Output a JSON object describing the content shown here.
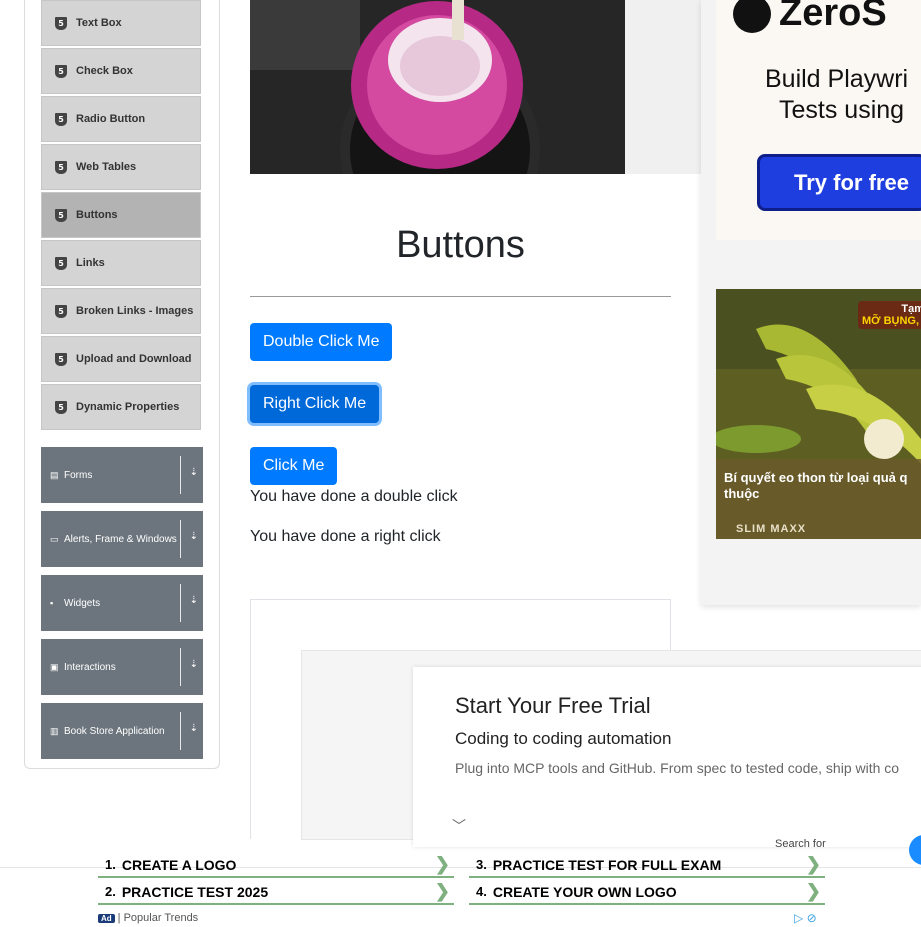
{
  "sidebar": {
    "items": [
      {
        "label": "Text Box",
        "icon": "html5-icon"
      },
      {
        "label": "Check Box",
        "icon": "html5-icon"
      },
      {
        "label": "Radio Button",
        "icon": "html5-icon"
      },
      {
        "label": "Web Tables",
        "icon": "html5-icon"
      },
      {
        "label": "Buttons",
        "icon": "html5-icon",
        "active": true
      },
      {
        "label": "Links",
        "icon": "html5-icon"
      },
      {
        "label": "Broken Links - Images",
        "icon": "html5-icon"
      },
      {
        "label": "Upload and Download",
        "icon": "html5-icon"
      },
      {
        "label": "Dynamic Properties",
        "icon": "html5-icon"
      }
    ],
    "groups": [
      {
        "label": "Forms",
        "icon": "form-icon"
      },
      {
        "label": "Alerts, Frame & Windows",
        "icon": "window-icon"
      },
      {
        "label": "Widgets",
        "icon": "grid-icon"
      },
      {
        "label": "Interactions",
        "icon": "interaction-icon"
      },
      {
        "label": "Book Store Application",
        "icon": "book-icon"
      }
    ]
  },
  "main": {
    "title": "Buttons",
    "buttons": {
      "double": "Double Click Me",
      "right": "Right Click Me",
      "click": "Click Me"
    },
    "messages": {
      "double": "You have done a double click",
      "right": "You have done a right click"
    }
  },
  "trial": {
    "title": "Start Your Free Trial",
    "subtitle": "Coding to coding automation",
    "body": "Plug into MCP tools and GitHub. From spec to tested code, ship with co"
  },
  "ads": {
    "zero": {
      "logo": "ZeroS",
      "line1": "Build Playwri",
      "line2": "Tests using",
      "cta": "Try for free"
    },
    "banana": {
      "tag1": "Tạm",
      "tag2": "MỠ BỤNG,",
      "text": "Bí quyết eo thon từ loại quả q thuộc",
      "brand": "SLIM MAXX"
    },
    "bottom": {
      "search_for": "Search for",
      "links": [
        {
          "num": "1.",
          "text": "CREATE A LOGO"
        },
        {
          "num": "3.",
          "text": "PRACTICE TEST FOR FULL EXAM"
        },
        {
          "num": "2.",
          "text": "PRACTICE TEST 2025"
        },
        {
          "num": "4.",
          "text": "CREATE YOUR OWN LOGO"
        }
      ],
      "badge": "Ad",
      "footer": "| Popular Trends"
    }
  },
  "colors": {
    "primary": "#007bff",
    "sidebar_item": "#d4d4d4",
    "sidebar_active": "#b3b3b3",
    "group_bg": "#6c757d"
  }
}
